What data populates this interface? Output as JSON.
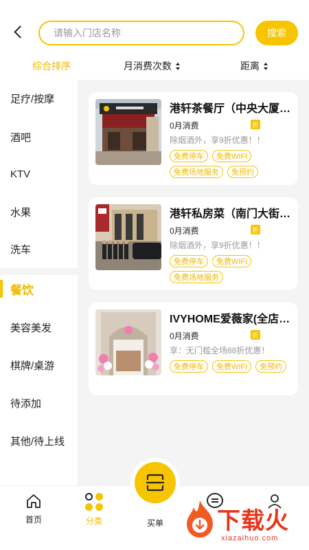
{
  "header": {
    "search_placeholder": "请输入门店名称",
    "search_button": "搜索"
  },
  "sort": {
    "items": [
      "综合排序",
      "月消费次数",
      "距离"
    ]
  },
  "sidebar": {
    "items": [
      {
        "label": "足疗/按摩"
      },
      {
        "label": "酒吧"
      },
      {
        "label": "KTV"
      },
      {
        "label": "水果"
      },
      {
        "label": "洗车"
      },
      {
        "label": "餐饮",
        "active": true
      },
      {
        "label": "美容美发"
      },
      {
        "label": "棋牌/桌游"
      },
      {
        "label": "待添加"
      },
      {
        "label": "其他/待上线"
      }
    ]
  },
  "stores": [
    {
      "name": "港轩茶餐厅（中央大厦店）",
      "sales": "0月消费",
      "badge": "折",
      "promo": "除烟酒外，享9折优惠！！",
      "tags": [
        "免费停车",
        "免费WIFI",
        "免费场地服务",
        "免预约"
      ]
    },
    {
      "name": "港轩私房菜（南门大街店）",
      "sales": "0月消费",
      "badge": "折",
      "promo": "除烟酒外，享9折优惠！！",
      "tags": [
        "免费停车",
        "免费WIFI",
        "免费场地服务"
      ]
    },
    {
      "name": "IVYHOME爱薇家(全店通用)",
      "sales": "0月消费",
      "badge": "折",
      "promo": "享：无门槛全场88折优惠！",
      "tags": [
        "免费停车",
        "免费WIFI",
        "免预约"
      ]
    }
  ],
  "bottom_nav": {
    "home": "首页",
    "category": "分类",
    "pay": "买单"
  },
  "watermark": {
    "main": "下载火",
    "sub": "xiazaihuo.com"
  },
  "colors": {
    "accent": "#f7c400",
    "background": "#f4f4f4"
  }
}
